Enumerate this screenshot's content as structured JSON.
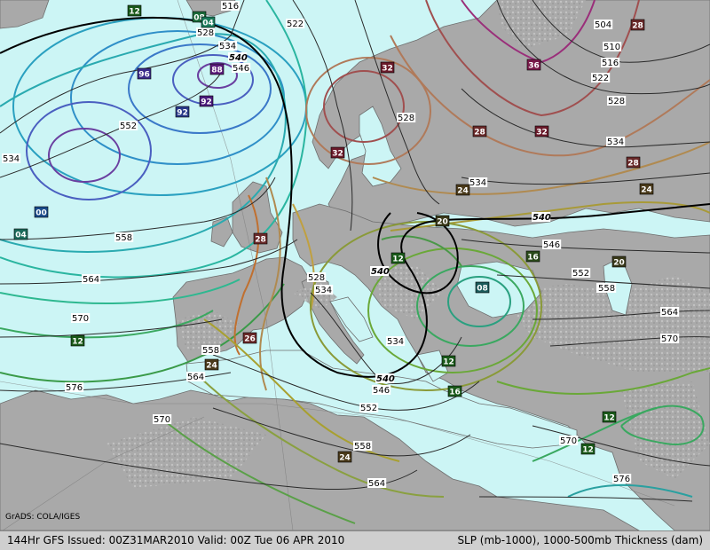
{
  "footer": {
    "left_text": "144Hr GFS Issued: 00Z31MAR2010 Valid: 00Z Tue 06 APR 2010",
    "right_text": "SLP (mb-1000), 1000-500mb Thickness (dam)"
  },
  "credit": "GrADS: COLA/IGES",
  "colors": {
    "sea": "#ccf5f5",
    "land": "#a8a8a8",
    "land_high": "#cdcdcd",
    "footer_bg": "#cfcfcf"
  },
  "thickness_labels": [
    {
      "id": "t516",
      "text": "516"
    },
    {
      "id": "t522a",
      "text": "522"
    },
    {
      "id": "t528a",
      "text": "528"
    },
    {
      "id": "t534a",
      "text": "534"
    },
    {
      "id": "t540a",
      "text": "540"
    },
    {
      "id": "t546a",
      "text": "546"
    },
    {
      "id": "t552a",
      "text": "552"
    },
    {
      "id": "t534b",
      "text": "534"
    },
    {
      "id": "t558a",
      "text": "558"
    },
    {
      "id": "t564a",
      "text": "564"
    },
    {
      "id": "t570a",
      "text": "570"
    },
    {
      "id": "t576a",
      "text": "576"
    },
    {
      "id": "t504",
      "text": "504"
    },
    {
      "id": "t510",
      "text": "510"
    },
    {
      "id": "t516b",
      "text": "516"
    },
    {
      "id": "t522b",
      "text": "522"
    },
    {
      "id": "t528b",
      "text": "528"
    },
    {
      "id": "t528c",
      "text": "528"
    },
    {
      "id": "t534c",
      "text": "534"
    },
    {
      "id": "t534d",
      "text": "534"
    },
    {
      "id": "t540b",
      "text": "540"
    },
    {
      "id": "t546b",
      "text": "546"
    },
    {
      "id": "t552b",
      "text": "552"
    },
    {
      "id": "t558b",
      "text": "558"
    },
    {
      "id": "t564b",
      "text": "564"
    },
    {
      "id": "t570b",
      "text": "570"
    },
    {
      "id": "t540c",
      "text": "540"
    },
    {
      "id": "t528d",
      "text": "528"
    },
    {
      "id": "t534e",
      "text": "534"
    },
    {
      "id": "t534f",
      "text": "534"
    },
    {
      "id": "t540d",
      "text": "540"
    },
    {
      "id": "t546c",
      "text": "546"
    },
    {
      "id": "t552c",
      "text": "552"
    },
    {
      "id": "t558c",
      "text": "558"
    },
    {
      "id": "t564c",
      "text": "564"
    },
    {
      "id": "t558d",
      "text": "558"
    },
    {
      "id": "t564d",
      "text": "564"
    },
    {
      "id": "t570c",
      "text": "570"
    },
    {
      "id": "t570d",
      "text": "570"
    },
    {
      "id": "t576b",
      "text": "576"
    },
    {
      "id": "t558e",
      "text": "558"
    }
  ],
  "pressure_boxes": [
    {
      "id": "p12a",
      "text": "12"
    },
    {
      "id": "p08a",
      "text": "08"
    },
    {
      "id": "p04a",
      "text": "04"
    },
    {
      "id": "p96",
      "text": "96"
    },
    {
      "id": "p88",
      "text": "88"
    },
    {
      "id": "p92a",
      "text": "92"
    },
    {
      "id": "p92b",
      "text": "92"
    },
    {
      "id": "p00",
      "text": "00"
    },
    {
      "id": "p04b",
      "text": "04"
    },
    {
      "id": "p12b",
      "text": "12"
    },
    {
      "id": "p28a",
      "text": "28"
    },
    {
      "id": "p32a",
      "text": "32"
    },
    {
      "id": "p36",
      "text": "36"
    },
    {
      "id": "p32b",
      "text": "32"
    },
    {
      "id": "p28b",
      "text": "28"
    },
    {
      "id": "p32c",
      "text": "32"
    },
    {
      "id": "p28c",
      "text": "28"
    },
    {
      "id": "p24a",
      "text": "24"
    },
    {
      "id": "p24b",
      "text": "24"
    },
    {
      "id": "p28d",
      "text": "28"
    },
    {
      "id": "p20a",
      "text": "20"
    },
    {
      "id": "p16a",
      "text": "16"
    },
    {
      "id": "p20b",
      "text": "20"
    },
    {
      "id": "p12c",
      "text": "12"
    },
    {
      "id": "p08b",
      "text": "08"
    },
    {
      "id": "p12d",
      "text": "12"
    },
    {
      "id": "p16b",
      "text": "16"
    },
    {
      "id": "p26",
      "text": "26"
    },
    {
      "id": "p24c",
      "text": "24"
    },
    {
      "id": "p24d",
      "text": "24"
    },
    {
      "id": "p12e",
      "text": "12"
    },
    {
      "id": "p12f",
      "text": "12"
    }
  ]
}
